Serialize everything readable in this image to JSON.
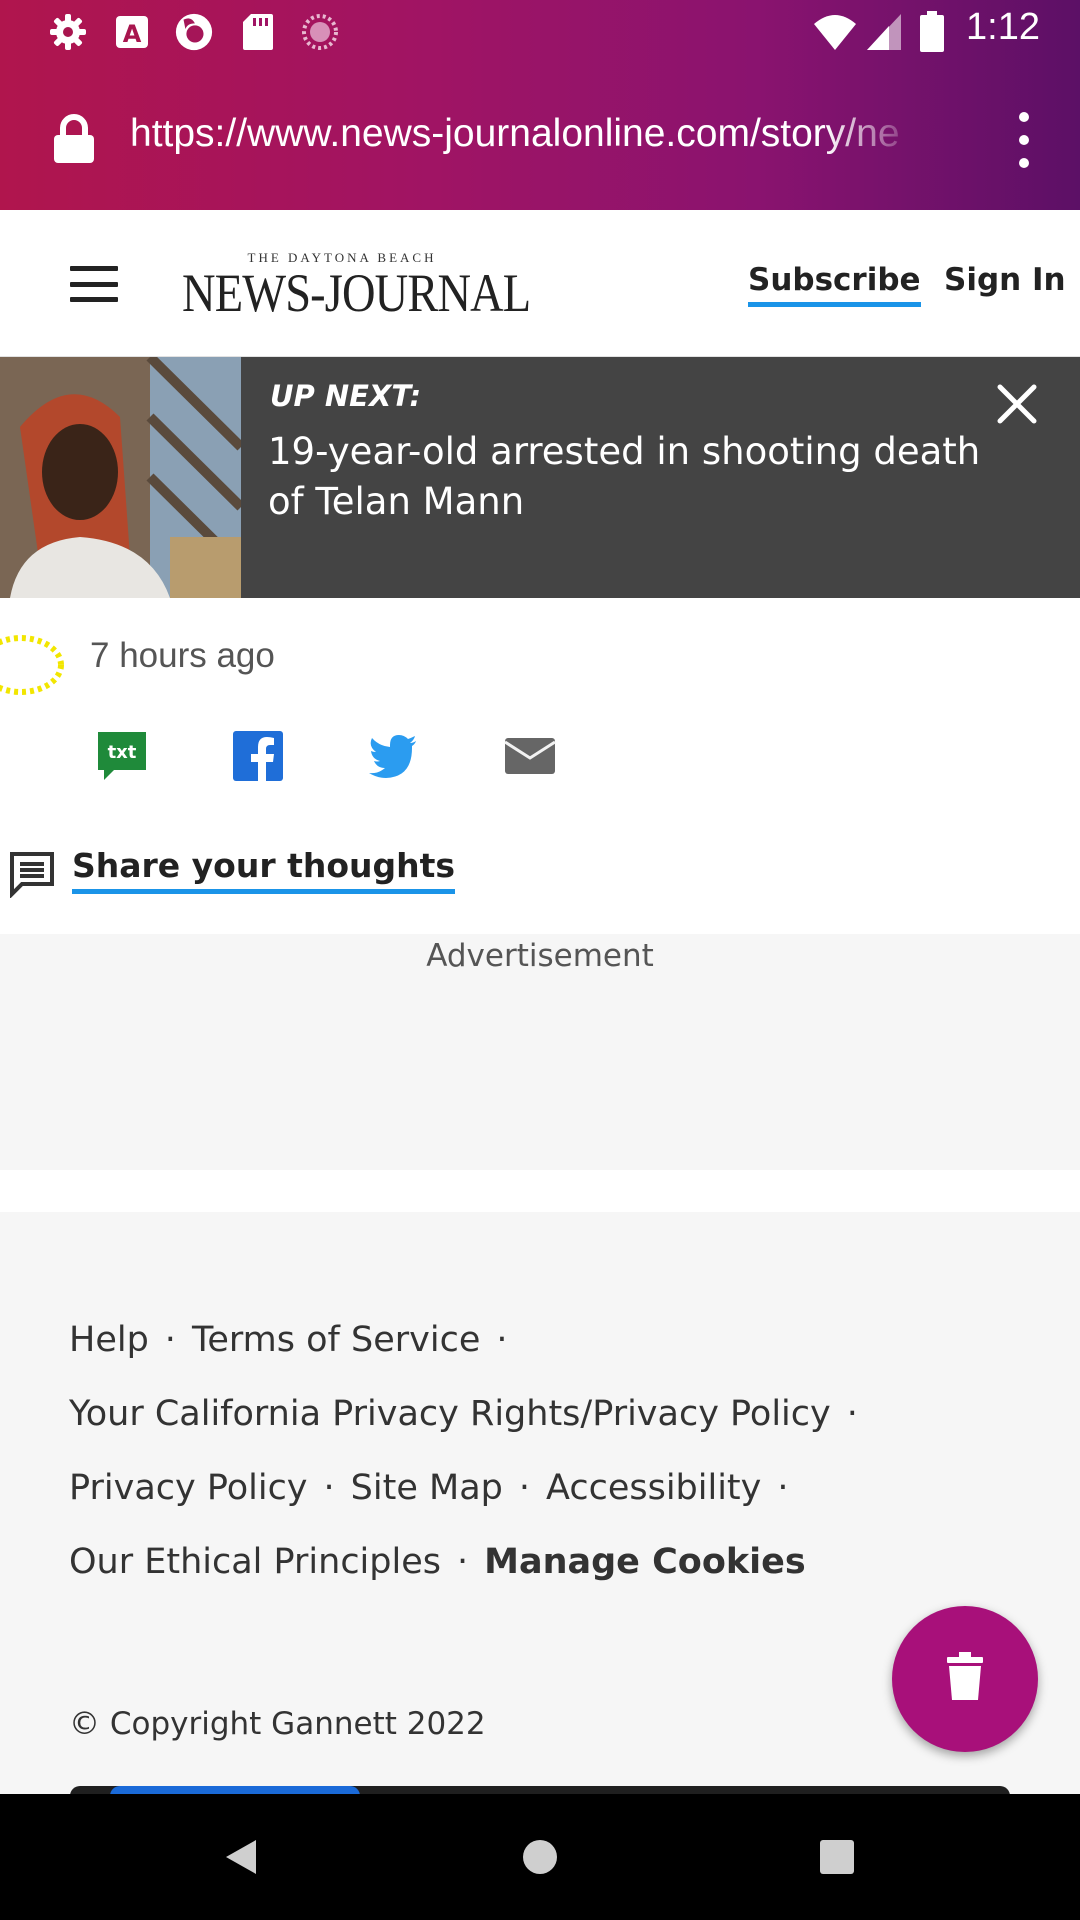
{
  "status_bar": {
    "time": "1:12",
    "left_icons": [
      "settings-icon",
      "a-icon",
      "firefox-icon",
      "sd-card-icon",
      "loading-icon"
    ],
    "right_icons": [
      "wifi-icon",
      "signal-icon",
      "battery-icon"
    ]
  },
  "browser": {
    "url": "https://www.news-journalonline.com/story/ne",
    "lock_icon": "lock-icon",
    "menu_icon": "more-vert-icon"
  },
  "header": {
    "logo_small": "THE DAYTONA BEACH",
    "logo_big": "NEWS-JOURNAL",
    "subscribe": "Subscribe",
    "sign_in": "Sign In",
    "accent": "#1a94e8"
  },
  "up_next": {
    "label": "UP NEXT:",
    "title": "19-year-old arrested in shooting death of Telan Mann",
    "background": "#444444"
  },
  "article": {
    "timestamp": "7 hours ago",
    "share_icons": [
      "txt-icon",
      "facebook-icon",
      "twitter-icon",
      "email-icon"
    ],
    "txt_label": "txt",
    "share_thoughts": "Share your thoughts"
  },
  "ad": {
    "label": "Advertisement"
  },
  "footer": {
    "links": {
      "help": "Help",
      "terms": "Terms of Service",
      "ca_privacy": "Your California Privacy Rights/Privacy Policy",
      "privacy": "Privacy Policy",
      "site_map": "Site Map",
      "accessibility": "Accessibility",
      "ethics": "Our Ethical Principles",
      "cookies": "Manage Cookies"
    },
    "separator": "·",
    "copyright": "© Copyright Gannett 2022"
  },
  "fab": {
    "icon": "trash-icon",
    "color": "#a8107a"
  },
  "nav_bar": {
    "buttons": [
      "back-icon",
      "home-icon",
      "recents-icon"
    ]
  }
}
